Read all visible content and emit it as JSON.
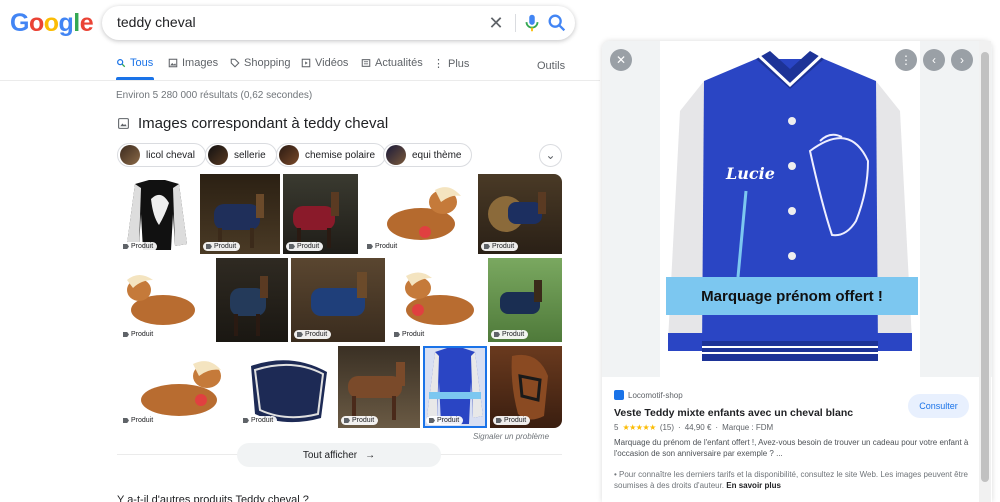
{
  "logo": {
    "letters": [
      "G",
      "o",
      "o",
      "g",
      "l",
      "e"
    ],
    "colors": [
      "#4285f4",
      "#ea4335",
      "#fbbc05",
      "#4285f4",
      "#34a853",
      "#ea4335"
    ]
  },
  "search": {
    "query": "teddy cheval"
  },
  "tabs": [
    {
      "label": "Tous",
      "icon": "search-icon",
      "active": true
    },
    {
      "label": "Images",
      "icon": "image-icon"
    },
    {
      "label": "Shopping",
      "icon": "tag-icon"
    },
    {
      "label": "Vidéos",
      "icon": "play-icon"
    },
    {
      "label": "Actualités",
      "icon": "news-icon"
    },
    {
      "label": "Plus",
      "icon": "more-vert-icon"
    }
  ],
  "tools_label": "Outils",
  "stats": "Environ 5 280 000 résultats (0,62 secondes)",
  "images_section": {
    "title": "Images correspondant à teddy cheval",
    "chips": [
      "licol cheval",
      "sellerie",
      "chemise polaire",
      "equi thème"
    ],
    "badge_label": "Produit",
    "report_label": "Signaler un problème",
    "show_all_label": "Tout afficher"
  },
  "detail": {
    "site": "Locomotif-shop",
    "title": "Veste Teddy mixte enfants avec un cheval blanc",
    "rating": "5",
    "stars": "★★★★★",
    "reviews": "(15)",
    "price": "44,90 €",
    "brand": "Marque : FDM",
    "description": "Marquage du prénom de l'enfant offert !, Avez-vous besoin de trouver un cadeau pour votre enfant à l'occasion de son anniversaire par exemple ? ...",
    "note": "• Pour connaître les derniers tarifs et la disponibilité, consultez le site Web. Les images peuvent être soumises à des droits d'auteur.",
    "note_link": "En savoir plus",
    "consult_label": "Consulter",
    "jacket_name": "Lucie",
    "banner": "Marquage prénom offert !"
  },
  "footer_cut": "Y a-t-il d'autres produits Teddy cheval ?",
  "colors": {
    "accent": "#1a73e8",
    "jacket_blue": "#2a45c4",
    "banner_blue": "#7cc7f0"
  }
}
